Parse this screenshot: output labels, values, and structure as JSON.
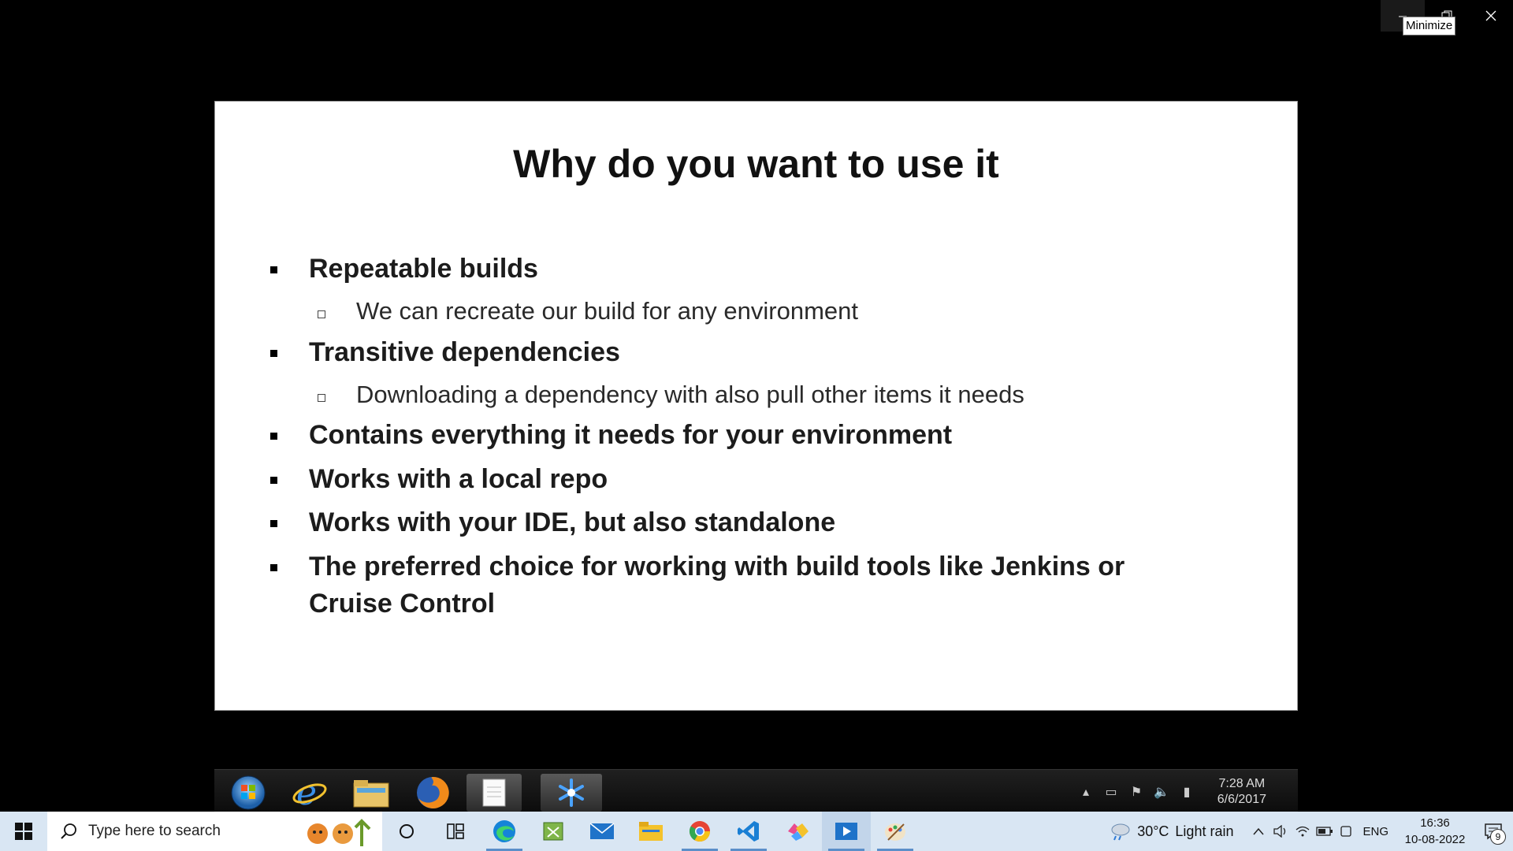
{
  "window": {
    "tooltip": "Minimize"
  },
  "slide": {
    "title": "Why do you want to use it",
    "bullets": [
      {
        "level": 1,
        "text": "Repeatable builds"
      },
      {
        "level": 2,
        "text": "We can recreate our build for any environment"
      },
      {
        "level": 1,
        "text": "Transitive dependencies"
      },
      {
        "level": 2,
        "text": "Downloading a dependency with also pull other items it needs"
      },
      {
        "level": 1,
        "text": "Contains everything it needs for your environment"
      },
      {
        "level": 1,
        "text": "Works with a local repo"
      },
      {
        "level": 1,
        "text": "Works with your IDE,  but also standalone"
      },
      {
        "level": 1,
        "text": "The preferred choice for working with build tools like Jenkins or"
      },
      {
        "level": 1,
        "text": "Cruise Control"
      }
    ]
  },
  "inner_taskbar": {
    "apps": [
      "windows-orb-icon",
      "internet-explorer-icon",
      "explorer-folder-icon",
      "firefox-icon",
      "notepad-icon",
      "snowflake-app-icon"
    ],
    "time": "7:28 AM",
    "date": "6/6/2017"
  },
  "taskbar": {
    "search_placeholder": "Type here to search",
    "apps": [
      "cortana-icon",
      "task-view-icon",
      "edge-icon",
      "excel-icon",
      "mail-icon",
      "file-explorer-icon",
      "chrome-icon",
      "vscode-icon",
      "app-icon",
      "media-player-icon",
      "paint-icon"
    ],
    "weather_temp": "30°C",
    "weather_text": "Light rain",
    "language": "ENG",
    "time": "16:36",
    "date": "10-08-2022",
    "notification_count": "9"
  }
}
